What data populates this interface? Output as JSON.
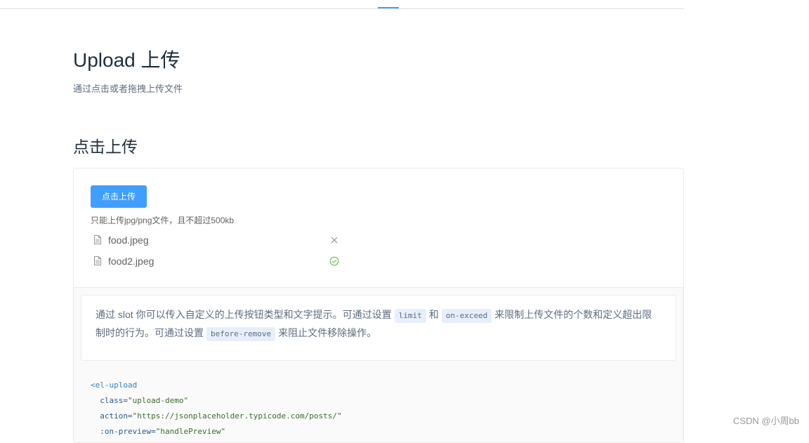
{
  "page": {
    "title": "Upload 上传",
    "description": "通过点击或者拖拽上传文件"
  },
  "section": {
    "title": "点击上传"
  },
  "demo": {
    "upload_button_label": "点击上传",
    "tip": "只能上传jpg/png文件，且不超过500kb",
    "files": [
      {
        "name": "food.jpeg",
        "status_icon": "close-icon"
      },
      {
        "name": "food2.jpeg",
        "status_icon": "success-circle-icon"
      }
    ],
    "description": {
      "part1": "通过 slot 你可以传入自定义的上传按钮类型和文字提示。可通过设置",
      "code1": "limit",
      "part2": "和",
      "code2": "on-exceed",
      "part3": "来限制上传文件的个数和定义超出限制时的行为。可通过设置",
      "code3": "before-remove",
      "part4": "来阻止文件移除操作。"
    },
    "code_lines": [
      {
        "tag": "<el-upload"
      },
      {
        "attr": "class=",
        "value": "\"upload-demo\""
      },
      {
        "attr": "action=",
        "value": "\"https://jsonplaceholder.typicode.com/posts/\""
      },
      {
        "attr": ":on-preview=",
        "value": "\"handlePreview\""
      }
    ]
  },
  "watermark": "CSDN @小周bb",
  "colors": {
    "primary": "#409eff",
    "success": "#67c23a",
    "text": "#606266"
  }
}
